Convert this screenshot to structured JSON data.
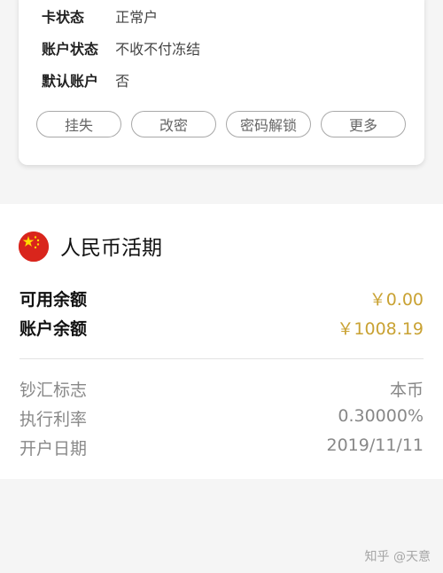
{
  "card": {
    "rows": [
      {
        "label": "卡状态",
        "value": "正常户"
      },
      {
        "label": "账户状态",
        "value": "不收不付冻结"
      },
      {
        "label": "默认账户",
        "value": "否"
      }
    ],
    "buttons": [
      "挂失",
      "改密",
      "密码解锁",
      "更多"
    ]
  },
  "account": {
    "flag_icon": "china-flag-icon",
    "title": "人民币活期",
    "available_label": "可用余额",
    "available_value": "￥0.00",
    "balance_label": "账户余额",
    "balance_value": "￥1008.19",
    "accent_color": "#c9a233",
    "details": [
      {
        "label": "钞汇标志",
        "value": "本币"
      },
      {
        "label": "执行利率",
        "value": "0.30000%"
      },
      {
        "label": "开户日期",
        "value": "2019/11/11"
      }
    ]
  },
  "watermark": "知乎 @天意"
}
